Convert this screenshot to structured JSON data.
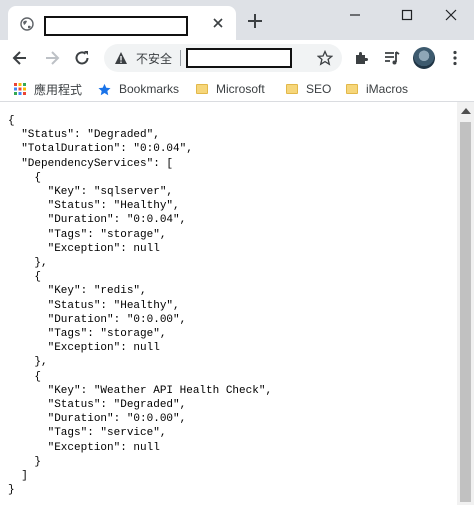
{
  "tab": {
    "favicon": "globe-icon"
  },
  "toolbar": {
    "security_label": "不安全"
  },
  "bookmarks": [
    {
      "label": "應用程式",
      "icon": "apps-grid-icon"
    },
    {
      "label": "Bookmarks",
      "icon": "star-icon"
    },
    {
      "label": "Microsoft",
      "icon": "folder-icon"
    },
    {
      "label": "SEO",
      "icon": "folder-icon"
    },
    {
      "label": "iMacros",
      "icon": "folder-icon"
    }
  ],
  "content": {
    "json_text": "{\n  \"Status\": \"Degraded\",\n  \"TotalDuration\": \"0:0.04\",\n  \"DependencyServices\": [\n    {\n      \"Key\": \"sqlserver\",\n      \"Status\": \"Healthy\",\n      \"Duration\": \"0:0.04\",\n      \"Tags\": \"storage\",\n      \"Exception\": null\n    },\n    {\n      \"Key\": \"redis\",\n      \"Status\": \"Healthy\",\n      \"Duration\": \"0:0.00\",\n      \"Tags\": \"storage\",\n      \"Exception\": null\n    },\n    {\n      \"Key\": \"Weather API Health Check\",\n      \"Status\": \"Degraded\",\n      \"Duration\": \"0:0.00\",\n      \"Tags\": \"service\",\n      \"Exception\": null\n    }\n  ]\n}"
  },
  "colors": {
    "tabstrip": "#dee1e6",
    "omnibox": "#f1f3f4",
    "scrollthumb": "#c1c1c1"
  }
}
